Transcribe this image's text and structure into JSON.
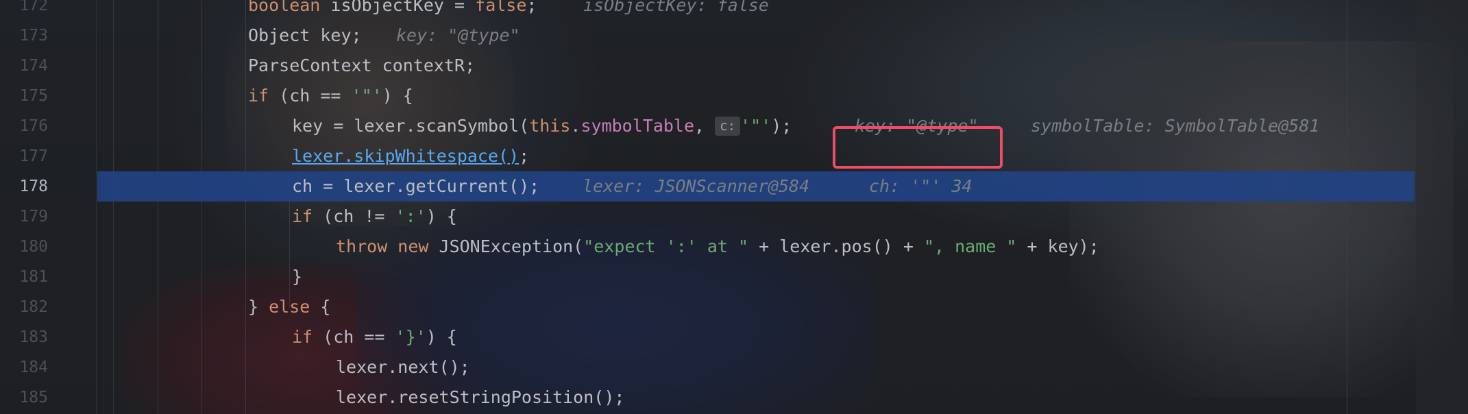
{
  "editor": {
    "lines": [
      {
        "number": "172",
        "tokens": [
          {
            "t": "boolean",
            "c": "kw"
          },
          {
            "t": " isObjectKey = ",
            "c": "plain"
          },
          {
            "t": "false",
            "c": "kw"
          },
          {
            "t": ";",
            "c": "plain"
          }
        ],
        "hints": [
          "isObjectKey: false"
        ]
      },
      {
        "number": "173",
        "tokens": [
          {
            "t": "Object key;",
            "c": "plain"
          }
        ],
        "hints": [
          "key: \"@type\""
        ]
      },
      {
        "number": "174",
        "tokens": [
          {
            "t": "ParseContext contextR;",
            "c": "plain"
          }
        ],
        "hints": []
      },
      {
        "number": "175",
        "tokens": [
          {
            "t": "if",
            "c": "kw"
          },
          {
            "t": " (ch == ",
            "c": "plain"
          },
          {
            "t": "'\"'",
            "c": "str"
          },
          {
            "t": ") {",
            "c": "plain"
          }
        ],
        "hints": []
      },
      {
        "number": "176",
        "tokens": [
          {
            "t": "key = lexer.scanSymbol(",
            "c": "plain"
          },
          {
            "t": "this",
            "c": "kw"
          },
          {
            "t": ".",
            "c": "plain"
          },
          {
            "t": "symbolTable",
            "c": "field"
          },
          {
            "t": ", ",
            "c": "plain"
          },
          {
            "t": "c:",
            "c": "badge"
          },
          {
            "t": "'\"'",
            "c": "str"
          },
          {
            "t": ");",
            "c": "plain"
          }
        ],
        "hints": [
          "key: \"@type\"",
          "symbolTable: SymbolTable@581"
        ]
      },
      {
        "number": "177",
        "tokens": [
          {
            "t": "lexer.skipWhitespace()",
            "c": "link"
          },
          {
            "t": ";",
            "c": "plain"
          }
        ],
        "hints": []
      },
      {
        "number": "178",
        "tokens": [
          {
            "t": "ch = lexer.getCurrent();",
            "c": "plain"
          }
        ],
        "hints": [
          "lexer: JSONScanner@584",
          "ch: '\"' 34"
        ],
        "current": true
      },
      {
        "number": "179",
        "tokens": [
          {
            "t": "if",
            "c": "kw"
          },
          {
            "t": " (ch != ",
            "c": "plain"
          },
          {
            "t": "':'",
            "c": "str"
          },
          {
            "t": ") {",
            "c": "plain"
          }
        ],
        "hints": []
      },
      {
        "number": "180",
        "tokens": [
          {
            "t": "throw new",
            "c": "kw"
          },
          {
            "t": " JSONException(",
            "c": "plain"
          },
          {
            "t": "\"expect ':' at \"",
            "c": "str"
          },
          {
            "t": " + lexer.pos() + ",
            "c": "plain"
          },
          {
            "t": "\", name \"",
            "c": "str"
          },
          {
            "t": " + key);",
            "c": "plain"
          }
        ],
        "hints": []
      },
      {
        "number": "181",
        "tokens": [
          {
            "t": "}",
            "c": "plain"
          }
        ],
        "hints": []
      },
      {
        "number": "182",
        "tokens": [
          {
            "t": "} ",
            "c": "plain"
          },
          {
            "t": "else",
            "c": "kw"
          },
          {
            "t": " {",
            "c": "plain"
          }
        ],
        "hints": []
      },
      {
        "number": "183",
        "tokens": [
          {
            "t": "if",
            "c": "kw"
          },
          {
            "t": " (ch == ",
            "c": "plain"
          },
          {
            "t": "'}'",
            "c": "str"
          },
          {
            "t": ") {",
            "c": "plain"
          }
        ],
        "hints": []
      },
      {
        "number": "184",
        "tokens": [
          {
            "t": "lexer.next();",
            "c": "plain"
          }
        ],
        "hints": []
      },
      {
        "number": "185",
        "tokens": [
          {
            "t": "lexer.resetStringPosition();",
            "c": "plain"
          }
        ],
        "hints": []
      }
    ]
  },
  "colors": {
    "keyword": "#cf8e6d",
    "string": "#6aab73",
    "field": "#c77dbb",
    "link": "#56a8f5",
    "hint": "#7a7e85",
    "current_line": "#214283",
    "highlight_box": "#ee4d63"
  }
}
